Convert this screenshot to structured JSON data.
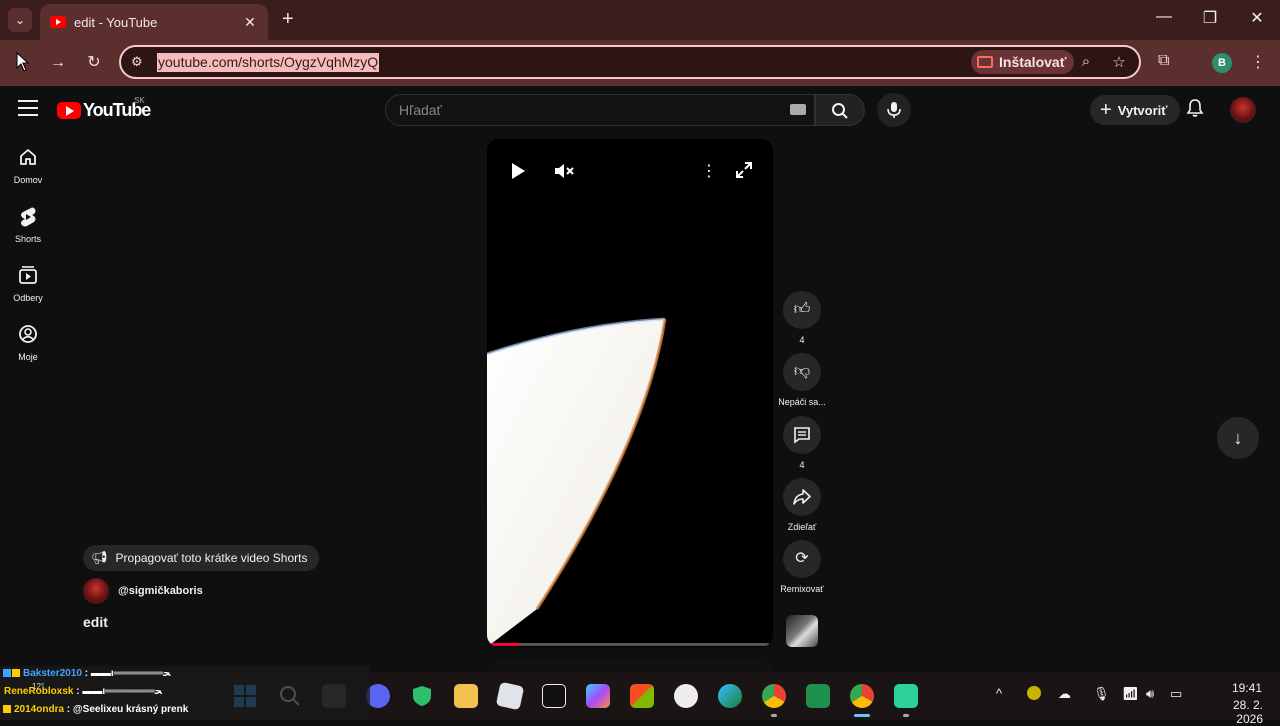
{
  "browser": {
    "tab_title": "edit - YouTube",
    "new_tab": "+",
    "url": "youtube.com/shorts/OygzVqhMzyQ",
    "install_label": "Inštalovať",
    "profile_letter": "B"
  },
  "youtube": {
    "logo_text": "YouTube",
    "country_code": "SK",
    "search_placeholder": "Hľadať",
    "create_label": "Vytvoriť"
  },
  "sidebar": {
    "items": [
      {
        "label": "Domov",
        "icon": "home-icon"
      },
      {
        "label": "Shorts",
        "icon": "shorts-icon"
      },
      {
        "label": "Odbery",
        "icon": "subscriptions-icon"
      },
      {
        "label": "Moje",
        "icon": "you-icon"
      }
    ]
  },
  "short": {
    "progress_fraction": 0.1,
    "channel": "@sigmičkaboris",
    "title": "edit",
    "promote_label": "Propagovať toto krátke video Shorts"
  },
  "actions": [
    {
      "icon": "like-icon",
      "label": "4"
    },
    {
      "icon": "dislike-icon",
      "label": "Nepáči sa..."
    },
    {
      "icon": "comments-icon",
      "label": "4"
    },
    {
      "icon": "share-icon",
      "label": "Zdieľať"
    },
    {
      "icon": "remix-icon",
      "label": "Remixovať"
    }
  ],
  "taskbar": {
    "time": "19:41",
    "date": "28. 2. 2026",
    "apps": [
      "start-icon",
      "search-icon",
      "task-view-icon",
      "discord-icon",
      "vpn-shield-icon",
      "file-explorer-icon",
      "roblox-icon",
      "capcut-icon",
      "copilot-icon",
      "microsoft-store-icon",
      "extension-app-icon",
      "edge-icon",
      "chrome-profile-icon",
      "video-app-icon",
      "chrome-icon",
      "streaming-app-icon"
    ]
  },
  "chat": {
    "temp": "12°",
    "lines": [
      {
        "user": "Bakster2010",
        "sep": " :",
        "msg": " ▬▬ι═══════ﺤ",
        "color": "#3ea6ff"
      },
      {
        "user": "ReneRobloxsk",
        "sep": " :",
        "msg": " ▬▬ι═══════ﺤ",
        "color": "#ffcc00"
      },
      {
        "user": "2014ondra",
        "sep": " :",
        "msg": " @Seelixeu krásný prenk",
        "color": "#ffd000"
      }
    ]
  }
}
